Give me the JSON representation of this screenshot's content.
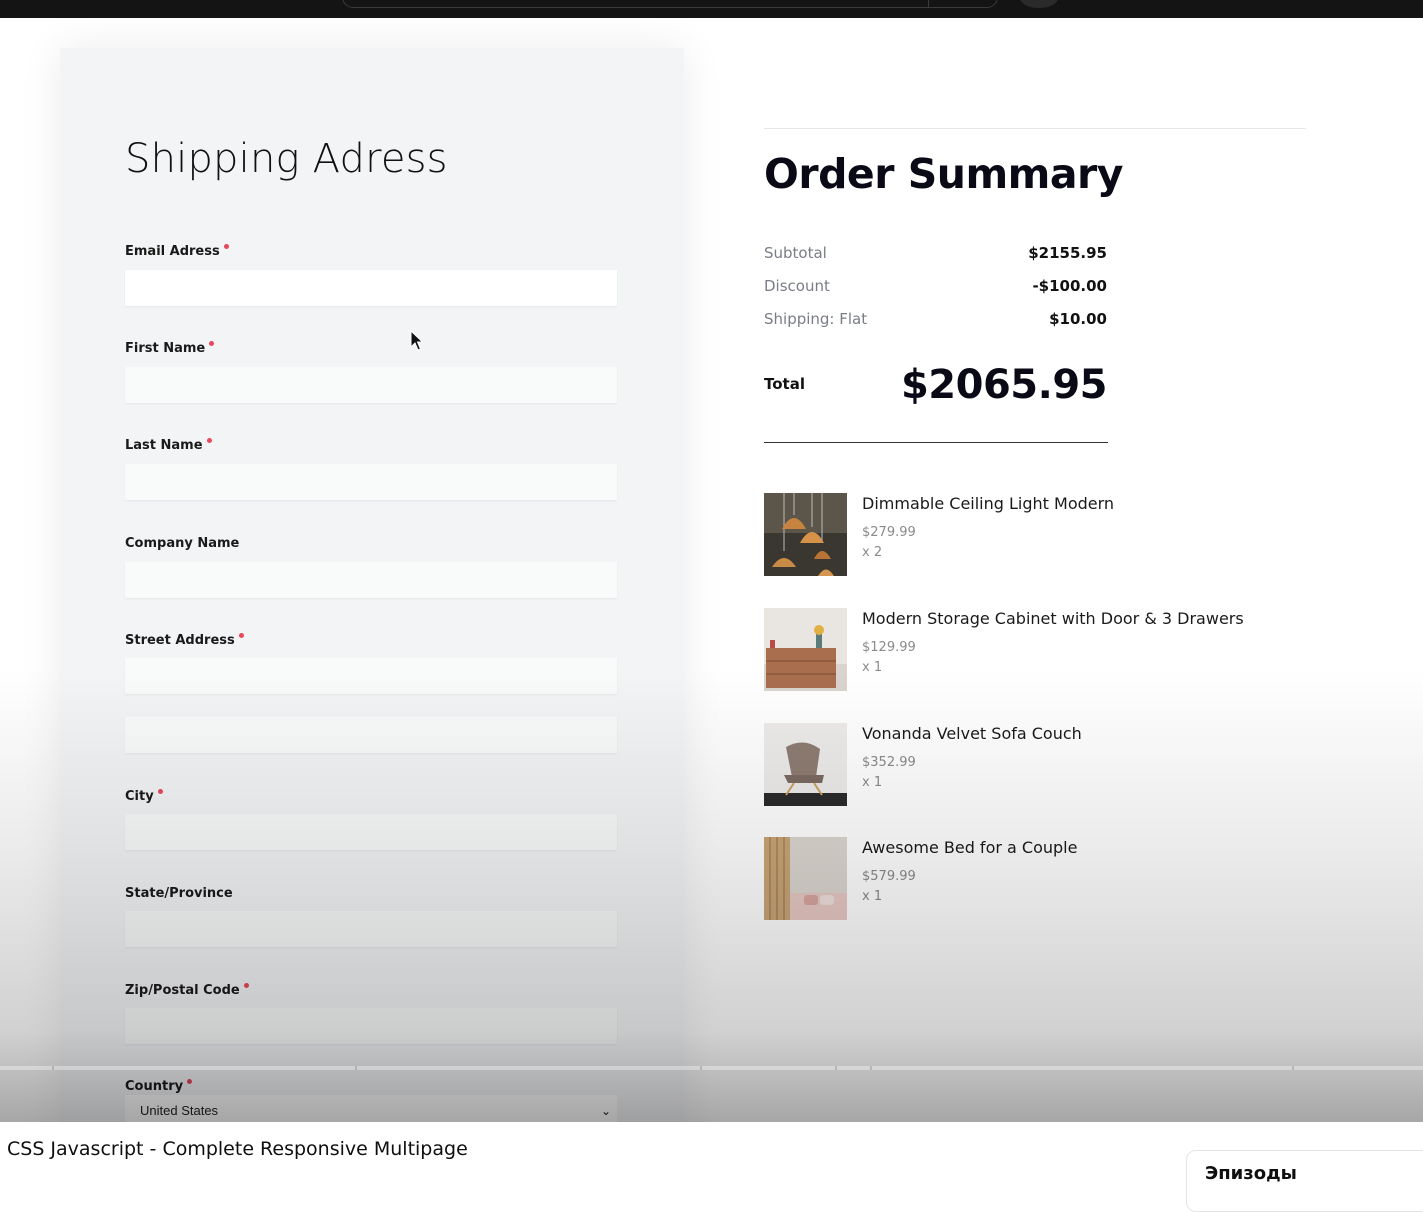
{
  "form": {
    "title": "Shipping Adress",
    "fields": {
      "email": {
        "label": "Email Adress",
        "required": true,
        "value": ""
      },
      "first_name": {
        "label": "First Name",
        "required": true,
        "value": ""
      },
      "last_name": {
        "label": "Last Name",
        "required": true,
        "value": ""
      },
      "company": {
        "label": "Company Name",
        "required": false,
        "value": ""
      },
      "street": {
        "label": "Street Address",
        "required": true,
        "value": ""
      },
      "street2": {
        "value": ""
      },
      "city": {
        "label": "City",
        "required": true,
        "value": ""
      },
      "state": {
        "label": "State/Province",
        "required": false,
        "value": ""
      },
      "zip": {
        "label": "Zip/Postal Code",
        "required": true,
        "value": ""
      },
      "country": {
        "label": "Country",
        "required": true,
        "selected": "United States"
      }
    },
    "required_color": "#e8495a"
  },
  "summary": {
    "title": "Order Summary",
    "subtotal_label": "Subtotal",
    "subtotal_value": "$2155.95",
    "discount_label": "Discount",
    "discount_value": "-$100.00",
    "shipping_label": "Shipping: Flat",
    "shipping_value": "$10.00",
    "total_label": "Total",
    "total_value": "$2065.95"
  },
  "items": [
    {
      "name": "Dimmable Ceiling Light Modern",
      "price": "$279.99",
      "qty": "x 2",
      "thumb": "pendant-lights-image"
    },
    {
      "name": "Modern Storage Cabinet with Door & 3 Drawers",
      "price": "$129.99",
      "qty": "x 1",
      "thumb": "cabinet-image"
    },
    {
      "name": "Vonanda Velvet Sofa Couch",
      "price": "$352.99",
      "qty": "x 1",
      "thumb": "chair-image"
    },
    {
      "name": "Awesome Bed for a Couple",
      "price": "$579.99",
      "qty": "x 1",
      "thumb": "bed-image"
    }
  ],
  "video": {
    "title": "CSS Javascript - Complete Responsive Multipage",
    "side_card_text": "Эпизоды"
  }
}
